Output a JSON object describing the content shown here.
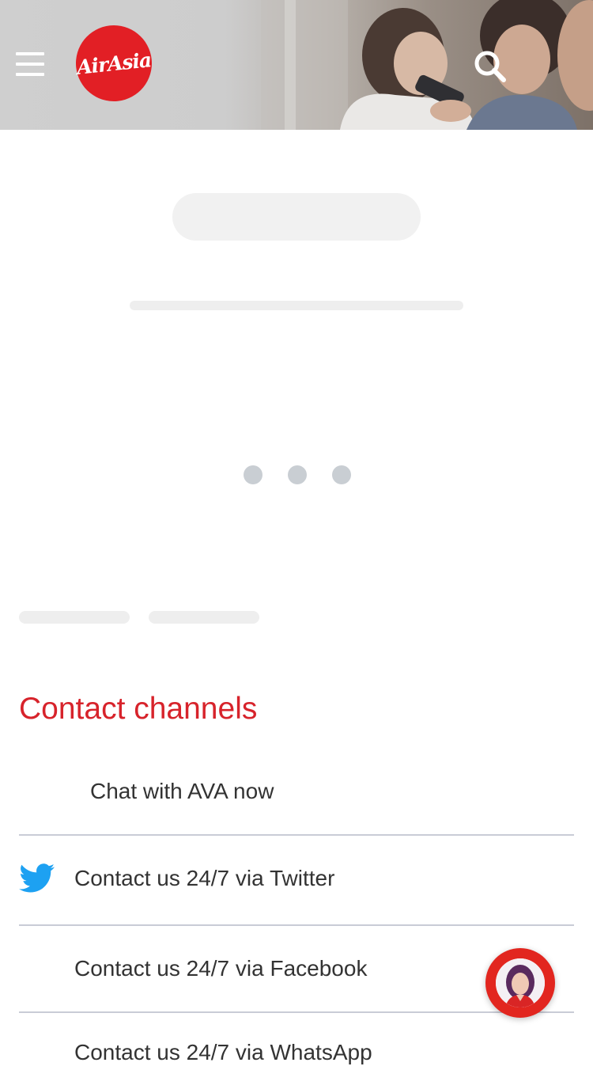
{
  "header": {
    "menu_icon": "hamburger-menu-icon",
    "logo_text": "AirAsia",
    "logo_color": "#e21f25",
    "search_icon": "search-icon"
  },
  "loading": {
    "indicator": "three-dot-loading-indicator",
    "dot_color": "#c9ced3"
  },
  "contact": {
    "title": "Contact channels",
    "title_color": "#d7232b",
    "channels": [
      {
        "label": "Chat with AVA now",
        "icon": ""
      },
      {
        "label": "Contact us 24/7 via Twitter",
        "icon": "twitter-icon"
      },
      {
        "label": "Contact us 24/7 via Facebook",
        "icon": ""
      },
      {
        "label": "Contact us 24/7 via WhatsApp",
        "icon": ""
      }
    ]
  },
  "ava_bubble": {
    "icon": "ava-avatar-icon",
    "color": "#e2261f"
  }
}
